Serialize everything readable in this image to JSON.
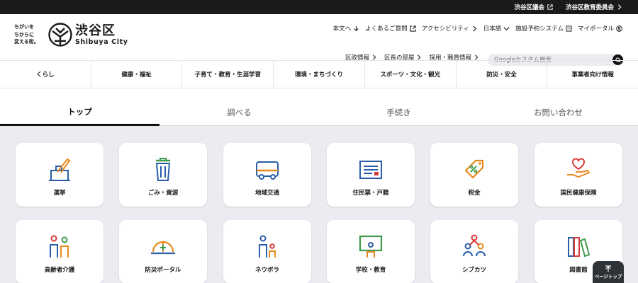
{
  "topbar": {
    "links": [
      "渋谷区議会",
      "渋谷区教育委員会"
    ]
  },
  "logo": {
    "slogan_lines": [
      "ちがいを",
      "ちからに",
      "変える街。"
    ],
    "name_ja": "渋谷区",
    "name_en": "Shibuya City"
  },
  "utility_nav": [
    "本文へ",
    "よくあるご質問",
    "アクセシビリティ",
    "日本語",
    "施設予約システム",
    "マイポータル"
  ],
  "sub_nav": [
    "区政情報",
    "区長の部屋",
    "採用・職員情報"
  ],
  "search": {
    "placeholder": "Googleカスタム検索"
  },
  "categories": [
    "くらし",
    "健康・福祉",
    "子育て・教育・生涯学習",
    "環境・まちづくり",
    "スポーツ・文化・観光",
    "防災・安全",
    "事業者向け情報"
  ],
  "tabs": [
    "トップ",
    "調べる",
    "手続き",
    "お問い合わせ"
  ],
  "cards": [
    "選挙",
    "ごみ・資源",
    "地域交通",
    "住民票・戸籍",
    "税金",
    "国民健康保険",
    "高齢者介護",
    "防災ポータル",
    "ネウボラ",
    "学校・教育",
    "シブカツ",
    "図書館"
  ],
  "page_top": "ページトップ",
  "colors": {
    "topbar": "#1a1a1a",
    "grid_bg": "#ebebf2",
    "icon_orange": "#e8891e",
    "icon_blue": "#2a5ea8",
    "icon_green": "#3f9a4a",
    "icon_red": "#d83b3b"
  }
}
